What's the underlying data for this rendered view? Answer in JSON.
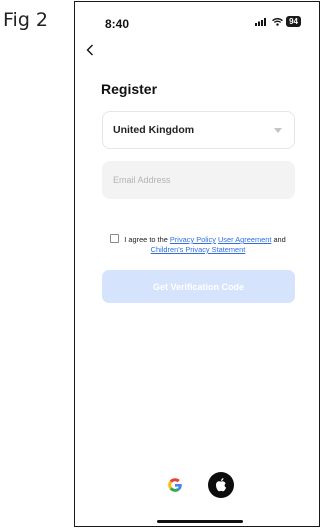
{
  "figure_label": "Fig 2",
  "status_bar": {
    "time": "8:40",
    "battery": "94",
    "icons": [
      "signal-icon",
      "wifi-icon",
      "battery-icon"
    ]
  },
  "header": {
    "back_icon": "chevron-left-icon",
    "title": "Register"
  },
  "form": {
    "country": {
      "selected": "United Kingdom",
      "icon": "chevron-down-icon"
    },
    "email": {
      "placeholder": "Email Address",
      "value": ""
    },
    "terms": {
      "checked": false,
      "prefix": "I agree to the",
      "privacy_policy": "Privacy Policy",
      "user_agreement": "User Agreement",
      "and": "and",
      "childrens_privacy": "Children's Privacy Statement"
    },
    "submit_label": "Get Verification Code"
  },
  "social_login": [
    "google-icon",
    "apple-icon"
  ],
  "colors": {
    "link": "#2f6fe0",
    "button_disabled": "#d5e4fc",
    "input_bg": "#f3f3f3"
  }
}
